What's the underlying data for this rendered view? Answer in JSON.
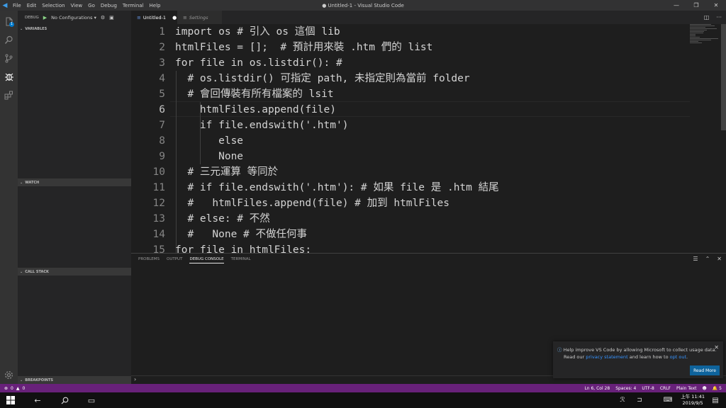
{
  "titlebar": {
    "menu": [
      "File",
      "Edit",
      "Selection",
      "View",
      "Go",
      "Debug",
      "Terminal",
      "Help"
    ],
    "title": "● Untitled-1 - Visual Studio Code",
    "controls": [
      "—",
      "❐",
      "✕"
    ]
  },
  "activity": {
    "badge": "1",
    "items": [
      "explorer-icon",
      "search-icon",
      "source-control-icon",
      "debug-icon",
      "extensions-icon",
      "settings-gear-icon"
    ]
  },
  "sidebar": {
    "debug_label": "DEBUG",
    "config_label": "No Configurations",
    "sections": {
      "variables": "VARIABLES",
      "watch": "WATCH",
      "call_stack": "CALL STACK",
      "breakpoints": "BREAKPOINTS"
    }
  },
  "tabs": {
    "active": "Untitled-1",
    "dirty_marker": "●",
    "inactive": "Settings"
  },
  "editor": {
    "lines": [
      {
        "n": "1",
        "code": "import os # 引入 os 這個 lib"
      },
      {
        "n": "2",
        "code": "htmlFiles = [];  # 預計用來裝 .htm 們的 list"
      },
      {
        "n": "3",
        "code": "for file in os.listdir(): #"
      },
      {
        "n": "4",
        "code": "  # os.listdir() 可指定 path, 未指定則為當前 folder"
      },
      {
        "n": "5",
        "code": "  # 會回傳裝有所有檔案的 lsit"
      },
      {
        "n": "6",
        "code": "    htmlFiles.append(file)"
      },
      {
        "n": "7",
        "code": "    if file.endswith('.htm')"
      },
      {
        "n": "8",
        "code": "       else"
      },
      {
        "n": "9",
        "code": "       None"
      },
      {
        "n": "10",
        "code": "  # 三元運算 等同於"
      },
      {
        "n": "11",
        "code": "  # if file.endswith('.htm'): # 如果 file 是 .htm 結尾"
      },
      {
        "n": "12",
        "code": "  #   htmlFiles.append(file) # 加到 htmlFiles"
      },
      {
        "n": "13",
        "code": "  # else: # 不然"
      },
      {
        "n": "14",
        "code": "  #   None # 不做任何事"
      },
      {
        "n": "15",
        "code": "for file in htmlFiles:"
      }
    ]
  },
  "panel": {
    "tabs": [
      "PROBLEMS",
      "OUTPUT",
      "DEBUG CONSOLE",
      "TERMINAL"
    ],
    "prompt": "›"
  },
  "notification": {
    "line1": "Help improve VS Code by allowing Microsoft to collect usage data.",
    "line2_prefix": "Read our",
    "privacy_link": "privacy statement",
    "line2_middle": "and learn how to",
    "opt_out_link": "opt out",
    "line2_suffix": ".",
    "button": "Read More",
    "close": "✕"
  },
  "statusbar": {
    "errors": "0",
    "warnings": "0",
    "position": "Ln 6, Col 28",
    "spaces": "Spaces: 4",
    "encoding": "UTF-8",
    "eol": "CRLF",
    "language": "Plain Text",
    "notifications": "5"
  },
  "taskbar": {
    "time": "上午 11:41",
    "date": "2019/9/5"
  },
  "colors": {
    "statusbar": "#68217a",
    "accent": "#007acc"
  }
}
